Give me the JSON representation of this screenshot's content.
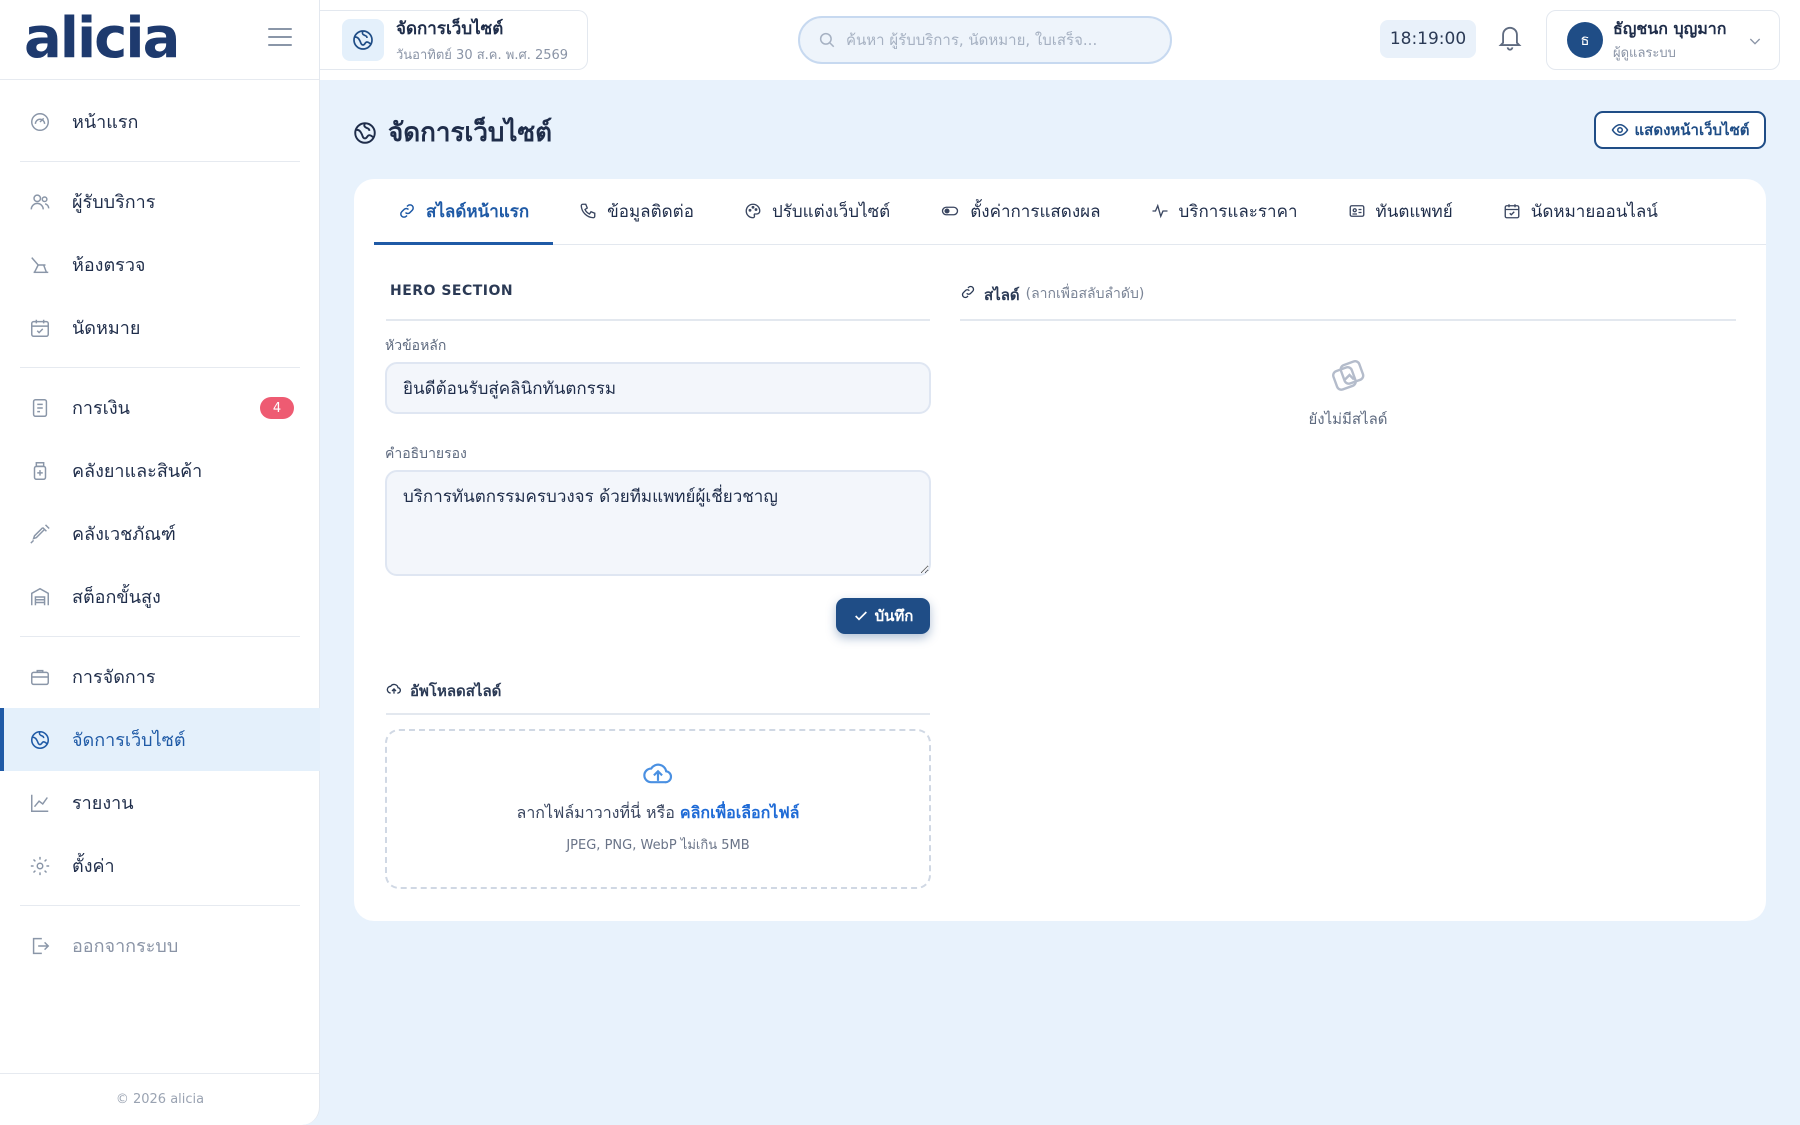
{
  "brand": {
    "logo": "alicia"
  },
  "sidebar": {
    "items": [
      {
        "label": "หน้าแรก",
        "icon": "dashboard-icon"
      },
      {
        "label": "ผู้รับบริการ",
        "icon": "users-icon"
      },
      {
        "label": "ห้องตรวจ",
        "icon": "dental-chair-icon"
      },
      {
        "label": "นัดหมาย",
        "icon": "calendar-icon"
      },
      {
        "label": "การเงิน",
        "icon": "receipt-icon",
        "badge": "4"
      },
      {
        "label": "คลังยาและสินค้า",
        "icon": "medicine-icon"
      },
      {
        "label": "คลังเวชภัณฑ์",
        "icon": "syringe-icon"
      },
      {
        "label": "สต็อกขั้นสูง",
        "icon": "warehouse-icon"
      },
      {
        "label": "การจัดการ",
        "icon": "briefcase-icon"
      },
      {
        "label": "จัดการเว็บไซต์",
        "icon": "globe-icon",
        "active": true
      },
      {
        "label": "รายงาน",
        "icon": "chart-line-icon"
      },
      {
        "label": "ตั้งค่า",
        "icon": "gear-icon"
      },
      {
        "label": "ออกจากระบบ",
        "icon": "logout-icon"
      }
    ],
    "footer": "© 2026 alicia"
  },
  "topbar": {
    "page_chip": {
      "title": "จัดการเว็บไซต์",
      "subtitle": "วันอาทิตย์ 30 ส.ค. พ.ศ. 2569"
    },
    "search": {
      "placeholder": "ค้นหา ผู้รับบริการ, นัดหมาย, ใบเสร็จ...",
      "value": ""
    },
    "clock": "18:19:00",
    "user": {
      "initial": "ธ",
      "name": "ธัญชนก บุญมาก",
      "role": "ผู้ดูแลระบบ"
    }
  },
  "page": {
    "title": "จัดการเว็บไซต์",
    "preview_label": "แสดงหน้าเว็บไซต์"
  },
  "tabs": [
    {
      "label": "สไลด์หน้าแรก",
      "icon": "link-icon",
      "active": true
    },
    {
      "label": "ข้อมูลติดต่อ",
      "icon": "phone-icon"
    },
    {
      "label": "ปรับแต่งเว็บไซต์",
      "icon": "palette-icon"
    },
    {
      "label": "ตั้งค่าการแสดงผล",
      "icon": "toggle-icon"
    },
    {
      "label": "บริการและราคา",
      "icon": "activity-icon"
    },
    {
      "label": "ทันตแพทย์",
      "icon": "id-card-icon"
    },
    {
      "label": "นัดหมายออนไลน์",
      "icon": "calendar-check-icon"
    }
  ],
  "hero": {
    "section_label": "HERO SECTION",
    "headline_label": "หัวข้อหลัก",
    "headline_value": "ยินดีต้อนรับสู่คลินิกทันตกรรม",
    "subtitle_label": "คำอธิบายรอง",
    "subtitle_value": "บริการทันตกรรมครบวงจร ด้วยทีมแพทย์ผู้เชี่ยวชาญ",
    "save_label": "บันทึก"
  },
  "upload": {
    "label": "อัพโหลดสไลด์",
    "drop_text": "ลากไฟล์มาวางที่นี่ หรือ",
    "link_text": "คลิกเพื่อเลือกไฟล์",
    "hint": "JPEG, PNG, WebP ไม่เกิน 5MB"
  },
  "slides": {
    "label": "สไลด์",
    "hint": "(ลากเพื่อสลับลำดับ)",
    "empty_text": "ยังไม่มีสไลด์"
  },
  "colors": {
    "primary": "#1f4d86",
    "accent": "#1f5aa6",
    "badge": "#ee5b72",
    "background": "#e8f2fc"
  }
}
